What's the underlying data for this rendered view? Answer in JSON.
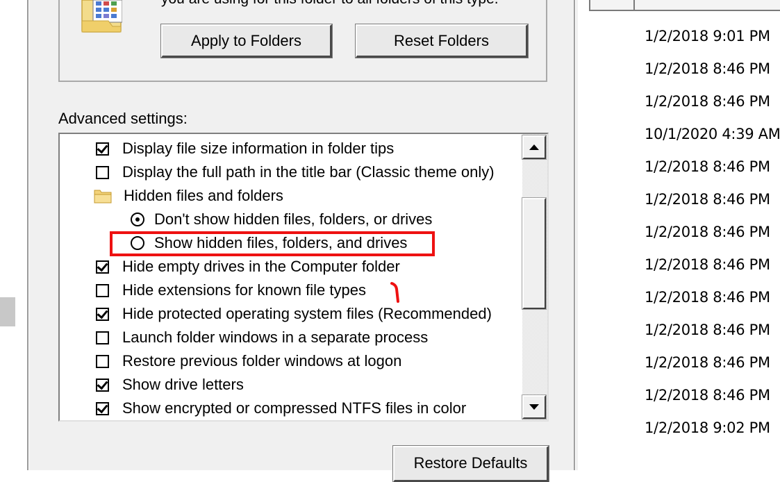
{
  "folder_views": {
    "description_fragment": "you are using for this folder to all folders of this type.",
    "apply_button": "Apply to Folders",
    "reset_button": "Reset Folders"
  },
  "advanced": {
    "label": "Advanced settings:",
    "items": [
      {
        "type": "checkbox",
        "checked": true,
        "label": "Display file size information in folder tips"
      },
      {
        "type": "checkbox",
        "checked": false,
        "label": "Display the full path in the title bar (Classic theme only)"
      },
      {
        "type": "folder",
        "label": "Hidden files and folders"
      },
      {
        "type": "radio",
        "selected": true,
        "label": "Don't show hidden files, folders, or drives"
      },
      {
        "type": "radio",
        "selected": false,
        "label": "Show hidden files, folders, and drives"
      },
      {
        "type": "checkbox",
        "checked": true,
        "label": "Hide empty drives in the Computer folder"
      },
      {
        "type": "checkbox",
        "checked": false,
        "label": "Hide extensions for known file types"
      },
      {
        "type": "checkbox",
        "checked": true,
        "label": "Hide protected operating system files (Recommended)"
      },
      {
        "type": "checkbox",
        "checked": false,
        "label": "Launch folder windows in a separate process"
      },
      {
        "type": "checkbox",
        "checked": false,
        "label": "Restore previous folder windows at logon"
      },
      {
        "type": "checkbox",
        "checked": true,
        "label": "Show drive letters"
      },
      {
        "type": "checkbox",
        "checked": true,
        "label": "Show encrypted or compressed NTFS files in color"
      }
    ],
    "restore_button": "Restore Defaults"
  },
  "annotation": {
    "highlight_color": "#ee1111"
  },
  "file_list": {
    "dates": [
      "1/2/2018 9:01 PM",
      "1/2/2018 8:46 PM",
      "1/2/2018 8:46 PM",
      "10/1/2020 4:39 AM",
      "1/2/2018 8:46 PM",
      "1/2/2018 8:46 PM",
      "1/2/2018 8:46 PM",
      "1/2/2018 8:46 PM",
      "1/2/2018 8:46 PM",
      "1/2/2018 8:46 PM",
      "1/2/2018 8:46 PM",
      "1/2/2018 8:46 PM",
      "1/2/2018 9:02 PM"
    ]
  }
}
